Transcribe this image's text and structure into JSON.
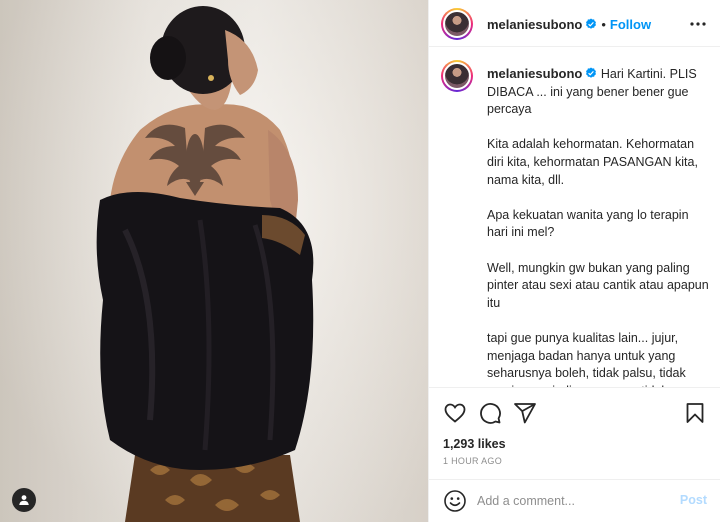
{
  "post": {
    "photo_alt": "woman-in-black-velvet-off-shoulder-dress-with-back-tattoo",
    "tag_icon": "user-tag-icon"
  },
  "header": {
    "username": "melaniesubono",
    "verified_icon": "verified-badge-icon",
    "separator": "•",
    "follow_label": "Follow",
    "more_icon": "more-options-icon"
  },
  "caption": {
    "username": "melaniesubono",
    "first_line": "Hari Kartini. PLIS DIBACA ... ini yang bener bener gue percaya",
    "paragraphs": [
      "Kita adalah kehormatan. Kehormatan diri kita, kehormatan PASANGAN kita, nama kita, dll.",
      "Apa kekuatan wanita yang lo terapin hari ini mel?",
      "Well, mungkin gw bukan yang paling pinter atau sexi atau cantik atau apapun itu",
      "tapi gue punya kualitas lain... jujur, menjaga badan hanya untuk yang seharusnya boleh, tidak palsu, tidak manja, menjadi orang yang tidak membuat keadaan atau hubungan"
    ]
  },
  "actions": {
    "like_icon": "heart-icon",
    "comment_icon": "comment-icon",
    "share_icon": "share-icon",
    "save_icon": "bookmark-icon"
  },
  "stats": {
    "likes": "1,293 likes",
    "time_ago": "1 HOUR AGO"
  },
  "comment_box": {
    "emoji_icon": "emoji-icon",
    "placeholder": "Add a comment...",
    "post_label": "Post"
  },
  "colors": {
    "link_blue": "#0095f6",
    "post_disabled": "#b3dbff",
    "text": "#262626",
    "muted": "#8e8e8e"
  }
}
